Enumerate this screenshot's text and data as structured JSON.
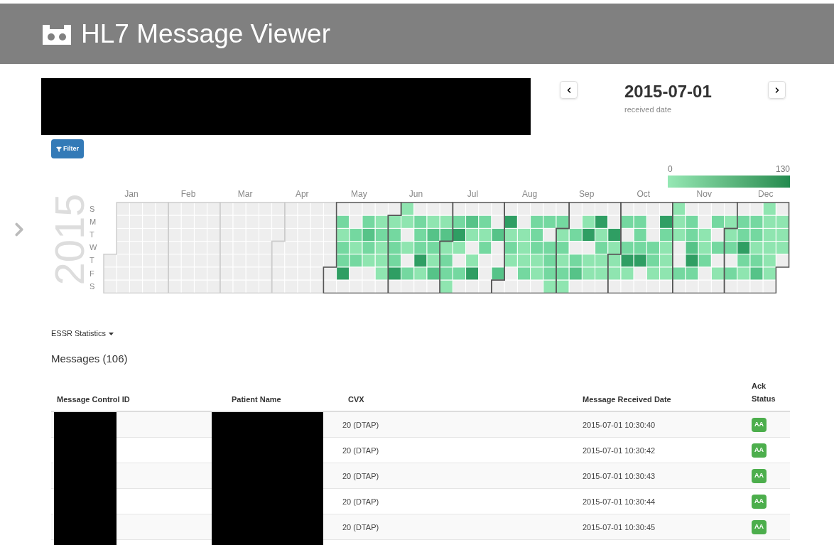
{
  "header": {
    "title": "HL7 Message Viewer"
  },
  "date_nav": {
    "date": "2015-07-01",
    "caption": "received date"
  },
  "filter_button": {
    "label": "Filter"
  },
  "calendar": {
    "year": "2015",
    "months": [
      "Jan",
      "Feb",
      "Mar",
      "Apr",
      "May",
      "Jun",
      "Jul",
      "Aug",
      "Sep",
      "Oct",
      "Nov",
      "Dec"
    ],
    "weekdays": [
      "S",
      "M",
      "T",
      "W",
      "T",
      "F",
      "S"
    ],
    "legend": {
      "min": "0",
      "max": "130"
    }
  },
  "stats_dropdown": {
    "label": "ESSR Statistics"
  },
  "messages": {
    "title": "Messages (106)",
    "columns": [
      "Message Control ID",
      "Patient Name",
      "CVX",
      "Message Received Date",
      "Ack Status"
    ],
    "rows": [
      {
        "cvx": "20 (DTAP)",
        "received": "2015-07-01 10:30:40",
        "ack": "AA"
      },
      {
        "cvx": "20 (DTAP)",
        "received": "2015-07-01 10:30:42",
        "ack": "AA"
      },
      {
        "cvx": "20 (DTAP)",
        "received": "2015-07-01 10:30:43",
        "ack": "AA"
      },
      {
        "cvx": "20 (DTAP)",
        "received": "2015-07-01 10:30:44",
        "ack": "AA"
      },
      {
        "cvx": "20 (DTAP)",
        "received": "2015-07-01 10:30:45",
        "ack": "AA"
      }
    ]
  }
}
